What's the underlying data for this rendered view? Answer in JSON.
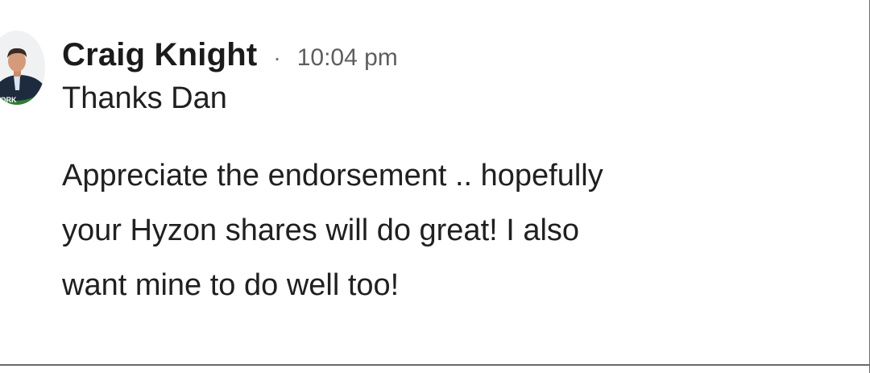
{
  "comment": {
    "author": "Craig Knight",
    "separator": "·",
    "time": "10:04 pm",
    "greeting": "Thanks Dan",
    "body_lines": [
      "Appreciate the endorsement .. hopefully",
      "your Hyzon shares will do great! I also",
      "want mine to do well too!"
    ]
  },
  "avatar": {
    "icon": "profile-photo",
    "badge_text": "WORK",
    "badge_color": "#2f7d32"
  }
}
